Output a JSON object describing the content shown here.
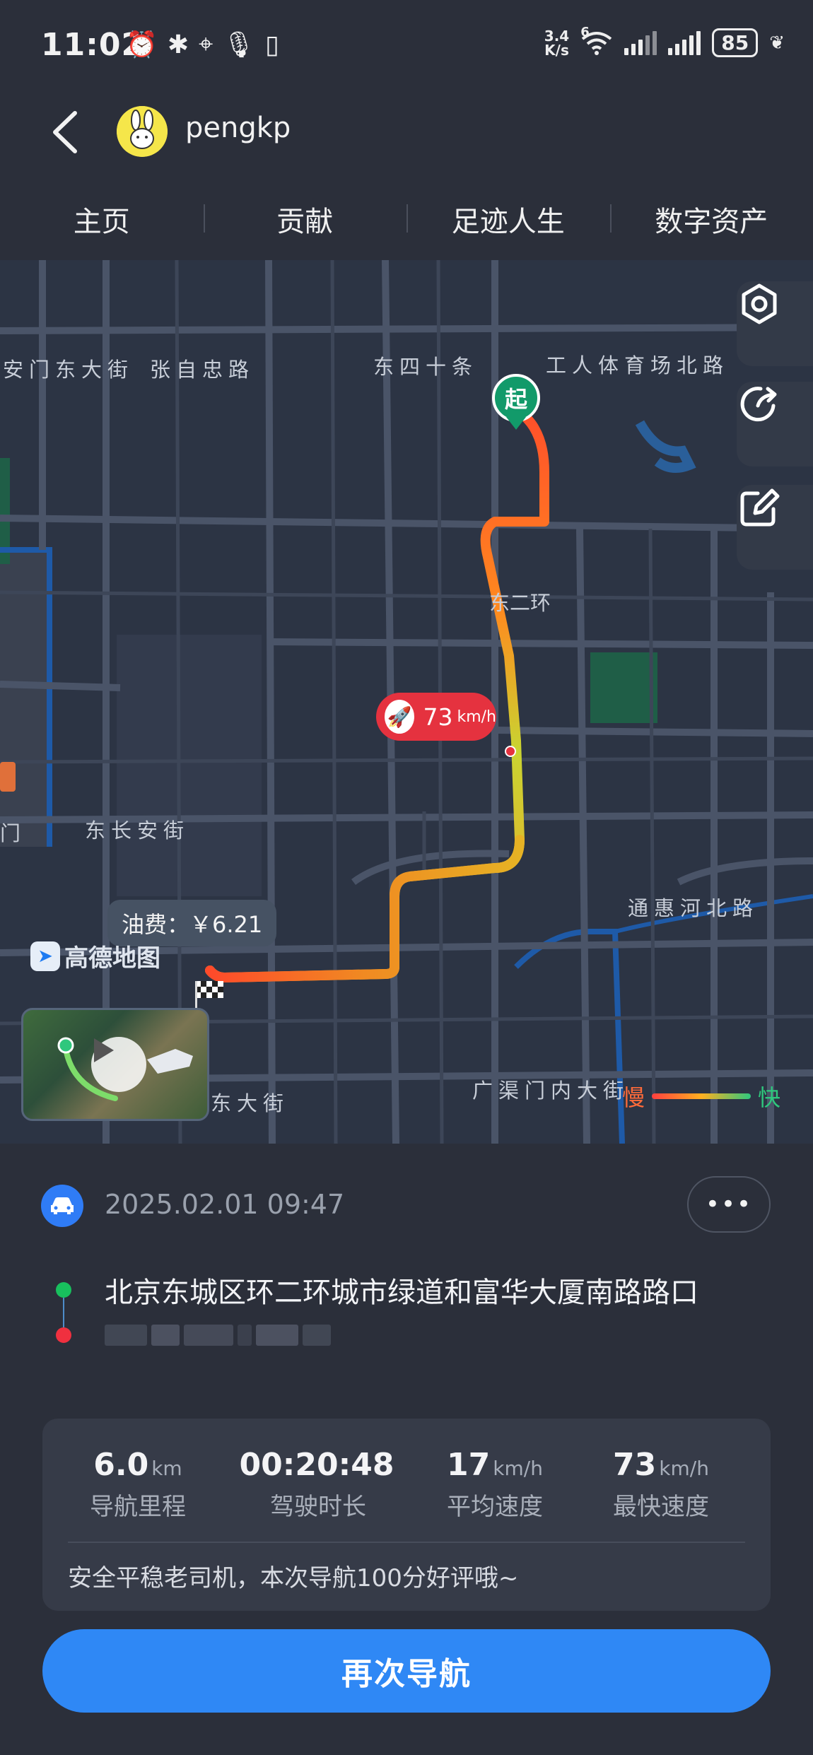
{
  "status_bar": {
    "time": "11:02",
    "net_speed_value": "3.4",
    "net_speed_unit": "K/s",
    "wifi_label": "6",
    "battery": "85"
  },
  "header": {
    "username": "pengkp"
  },
  "tabs": [
    "主页",
    "贡献",
    "足迹人生",
    "数字资产"
  ],
  "map": {
    "labels": {
      "anmen_dongdajie": "安门东大街",
      "zhangzizhong_road": "张自忠路",
      "dongsi_shitiao": "东四十条",
      "gongren_tiyuchang": "工人体育场北路",
      "dong_er_huan": "东二环",
      "men": "门",
      "dong_changan": "东长安街",
      "tonghuihe_north": "通惠河北路",
      "dongdajie": "东大街",
      "guangqumen_nei": "广渠门内大街"
    },
    "start_marker": "起",
    "speed_bubble": {
      "value": "73",
      "unit": "km/h"
    },
    "fuel_bubble": "油费：￥6.21",
    "amap_logo": "高德地图",
    "legend": {
      "slow": "慢",
      "fast": "快"
    },
    "route_colors": {
      "slow": "#ff3f3f",
      "medium": "#ffb020",
      "fast": "#c9d431"
    }
  },
  "trip": {
    "date": "2025.02.01 09:47",
    "more": "•••",
    "from": "北京东城区环二环城市绿道和富华大厦南路路口",
    "to_redacted": true,
    "stats": [
      {
        "value": "6.0",
        "unit": "km",
        "label": "导航里程"
      },
      {
        "value": "00:20:48",
        "unit": "",
        "label": "驾驶时长"
      },
      {
        "value": "17",
        "unit": "km/h",
        "label": "平均速度"
      },
      {
        "value": "73",
        "unit": "km/h",
        "label": "最快速度"
      }
    ],
    "note": "安全平稳老司机，本次导航100分好评哦~"
  },
  "nav_again_button": "再次导航",
  "colors": {
    "primary": "#2f88f5",
    "start_green": "#18c05d",
    "end_red": "#f0303f",
    "speed_red": "#e5323f"
  }
}
